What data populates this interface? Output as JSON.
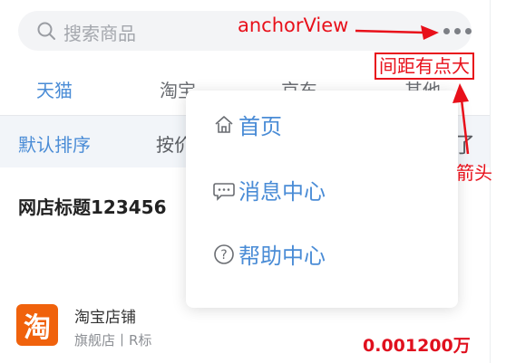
{
  "search": {
    "placeholder": "搜索商品"
  },
  "tabs": [
    {
      "label": "天猫"
    },
    {
      "label": "淘宝"
    },
    {
      "label": "京东"
    },
    {
      "label": "其他"
    }
  ],
  "sortbar": [
    {
      "label": "默认排序"
    },
    {
      "label": "按价"
    }
  ],
  "product": {
    "title": "网店标题123456",
    "logo_char": "淘",
    "shop_name": "淘宝店铺",
    "shop_type": "旗舰店丨R标",
    "price": "0.001200万"
  },
  "popover": {
    "items": [
      {
        "label": "首页",
        "icon": "home-icon"
      },
      {
        "label": "消息中心",
        "icon": "chat-bubble-icon"
      },
      {
        "label": "帮助中心",
        "icon": "help-circle-icon"
      }
    ]
  },
  "annotations": {
    "anchor": "anchorView",
    "spacing": "间距有点大",
    "arrow": "箭头"
  },
  "colors": {
    "accent": "#4a8cd6",
    "annotation": "#e8101a",
    "price": "#e0101e",
    "logo": "#f0620c"
  }
}
